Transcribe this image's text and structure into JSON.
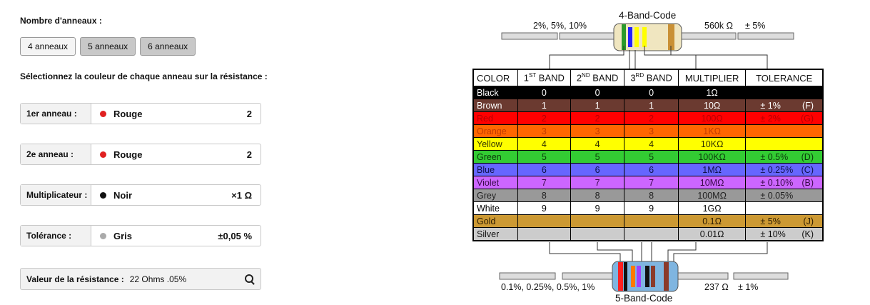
{
  "form": {
    "rings_label": "Nombre d'anneaux :",
    "buttons": [
      "4 anneaux",
      "5 anneaux",
      "6 anneaux"
    ],
    "select_label": "Sélectionnez la couleur de chaque anneau sur la résistance :",
    "rows": [
      {
        "label": "1er anneau :",
        "color_name": "Rouge",
        "value": "2",
        "dot": "#e02020"
      },
      {
        "label": "2e anneau :",
        "color_name": "Rouge",
        "value": "2",
        "dot": "#e02020"
      },
      {
        "label": "Multiplicateur :",
        "color_name": "Noir",
        "value": "×1 Ω",
        "dot": "#111111"
      },
      {
        "label": "Tolérance :",
        "color_name": "Gris",
        "value": "±0,05 %",
        "dot": "#aaaaaa"
      }
    ],
    "result_label": "Valeur de la résistance :",
    "result_value": "22 Ohms .05%"
  },
  "diagram": {
    "top_title": "4-Band-Code",
    "top_left": "2%, 5%, 10%",
    "top_right_value": "560k Ω",
    "top_right_tol": "± 5%",
    "bottom_title": "5-Band-Code",
    "bottom_left": "0.1%, 0.25%, 0.5%, 1%",
    "bottom_right_value": "237 Ω",
    "bottom_right_tol": "± 1%"
  },
  "table": {
    "headers": [
      "COLOR",
      "1",
      "ST",
      " BAND",
      "2",
      "ND",
      " BAND",
      "3",
      "RD",
      " BAND",
      "MULTIPLIER",
      "TOLERANCE"
    ],
    "rows": [
      {
        "color": "Black",
        "b1": "0",
        "b2": "0",
        "b3": "0",
        "mult": "1Ω",
        "tol": "",
        "code": "",
        "bg": "#000000",
        "fg": "#ffffff"
      },
      {
        "color": "Brown",
        "b1": "1",
        "b2": "1",
        "b3": "1",
        "mult": "10Ω",
        "tol": "± 1%",
        "code": "(F)",
        "bg": "#6b3a30",
        "fg": "#ffffff"
      },
      {
        "color": "Red",
        "b1": "2",
        "b2": "2",
        "b3": "2",
        "mult": "100Ω",
        "tol": "± 2%",
        "code": "(G)",
        "bg": "#ff0000",
        "fg": "#b80000"
      },
      {
        "color": "Orange",
        "b1": "3",
        "b2": "3",
        "b3": "3",
        "mult": "1KΩ",
        "tol": "",
        "code": "",
        "bg": "#ff6600",
        "fg": "#c23a00"
      },
      {
        "color": "Yellow",
        "b1": "4",
        "b2": "4",
        "b3": "4",
        "mult": "10KΩ",
        "tol": "",
        "code": "",
        "bg": "#ffff00",
        "fg": "#333300"
      },
      {
        "color": "Green",
        "b1": "5",
        "b2": "5",
        "b3": "5",
        "mult": "100KΩ",
        "tol": "± 0.5%",
        "code": "(D)",
        "bg": "#33cc33",
        "fg": "#0a3a0a"
      },
      {
        "color": "Blue",
        "b1": "6",
        "b2": "6",
        "b3": "6",
        "mult": "1MΩ",
        "tol": "± 0.25%",
        "code": "(C)",
        "bg": "#6666ff",
        "fg": "#10104a"
      },
      {
        "color": "Violet",
        "b1": "7",
        "b2": "7",
        "b3": "7",
        "mult": "10MΩ",
        "tol": "± 0.10%",
        "code": "(B)",
        "bg": "#cc66ff",
        "fg": "#3a0a4a"
      },
      {
        "color": "Grey",
        "b1": "8",
        "b2": "8",
        "b3": "8",
        "mult": "100MΩ",
        "tol": "± 0.05%",
        "code": "",
        "bg": "#999999",
        "fg": "#222222"
      },
      {
        "color": "White",
        "b1": "9",
        "b2": "9",
        "b3": "9",
        "mult": "1GΩ",
        "tol": "",
        "code": "",
        "bg": "#ffffff",
        "fg": "#000000"
      },
      {
        "color": "Gold",
        "b1": "",
        "b2": "",
        "b3": "",
        "mult": "0.1Ω",
        "tol": "± 5%",
        "code": "(J)",
        "bg": "#cc9933",
        "fg": "#2a1a00"
      },
      {
        "color": "Silver",
        "b1": "",
        "b2": "",
        "b3": "",
        "mult": "0.01Ω",
        "tol": "± 10%",
        "code": "(K)",
        "bg": "#cccccc",
        "fg": "#111111"
      }
    ]
  }
}
